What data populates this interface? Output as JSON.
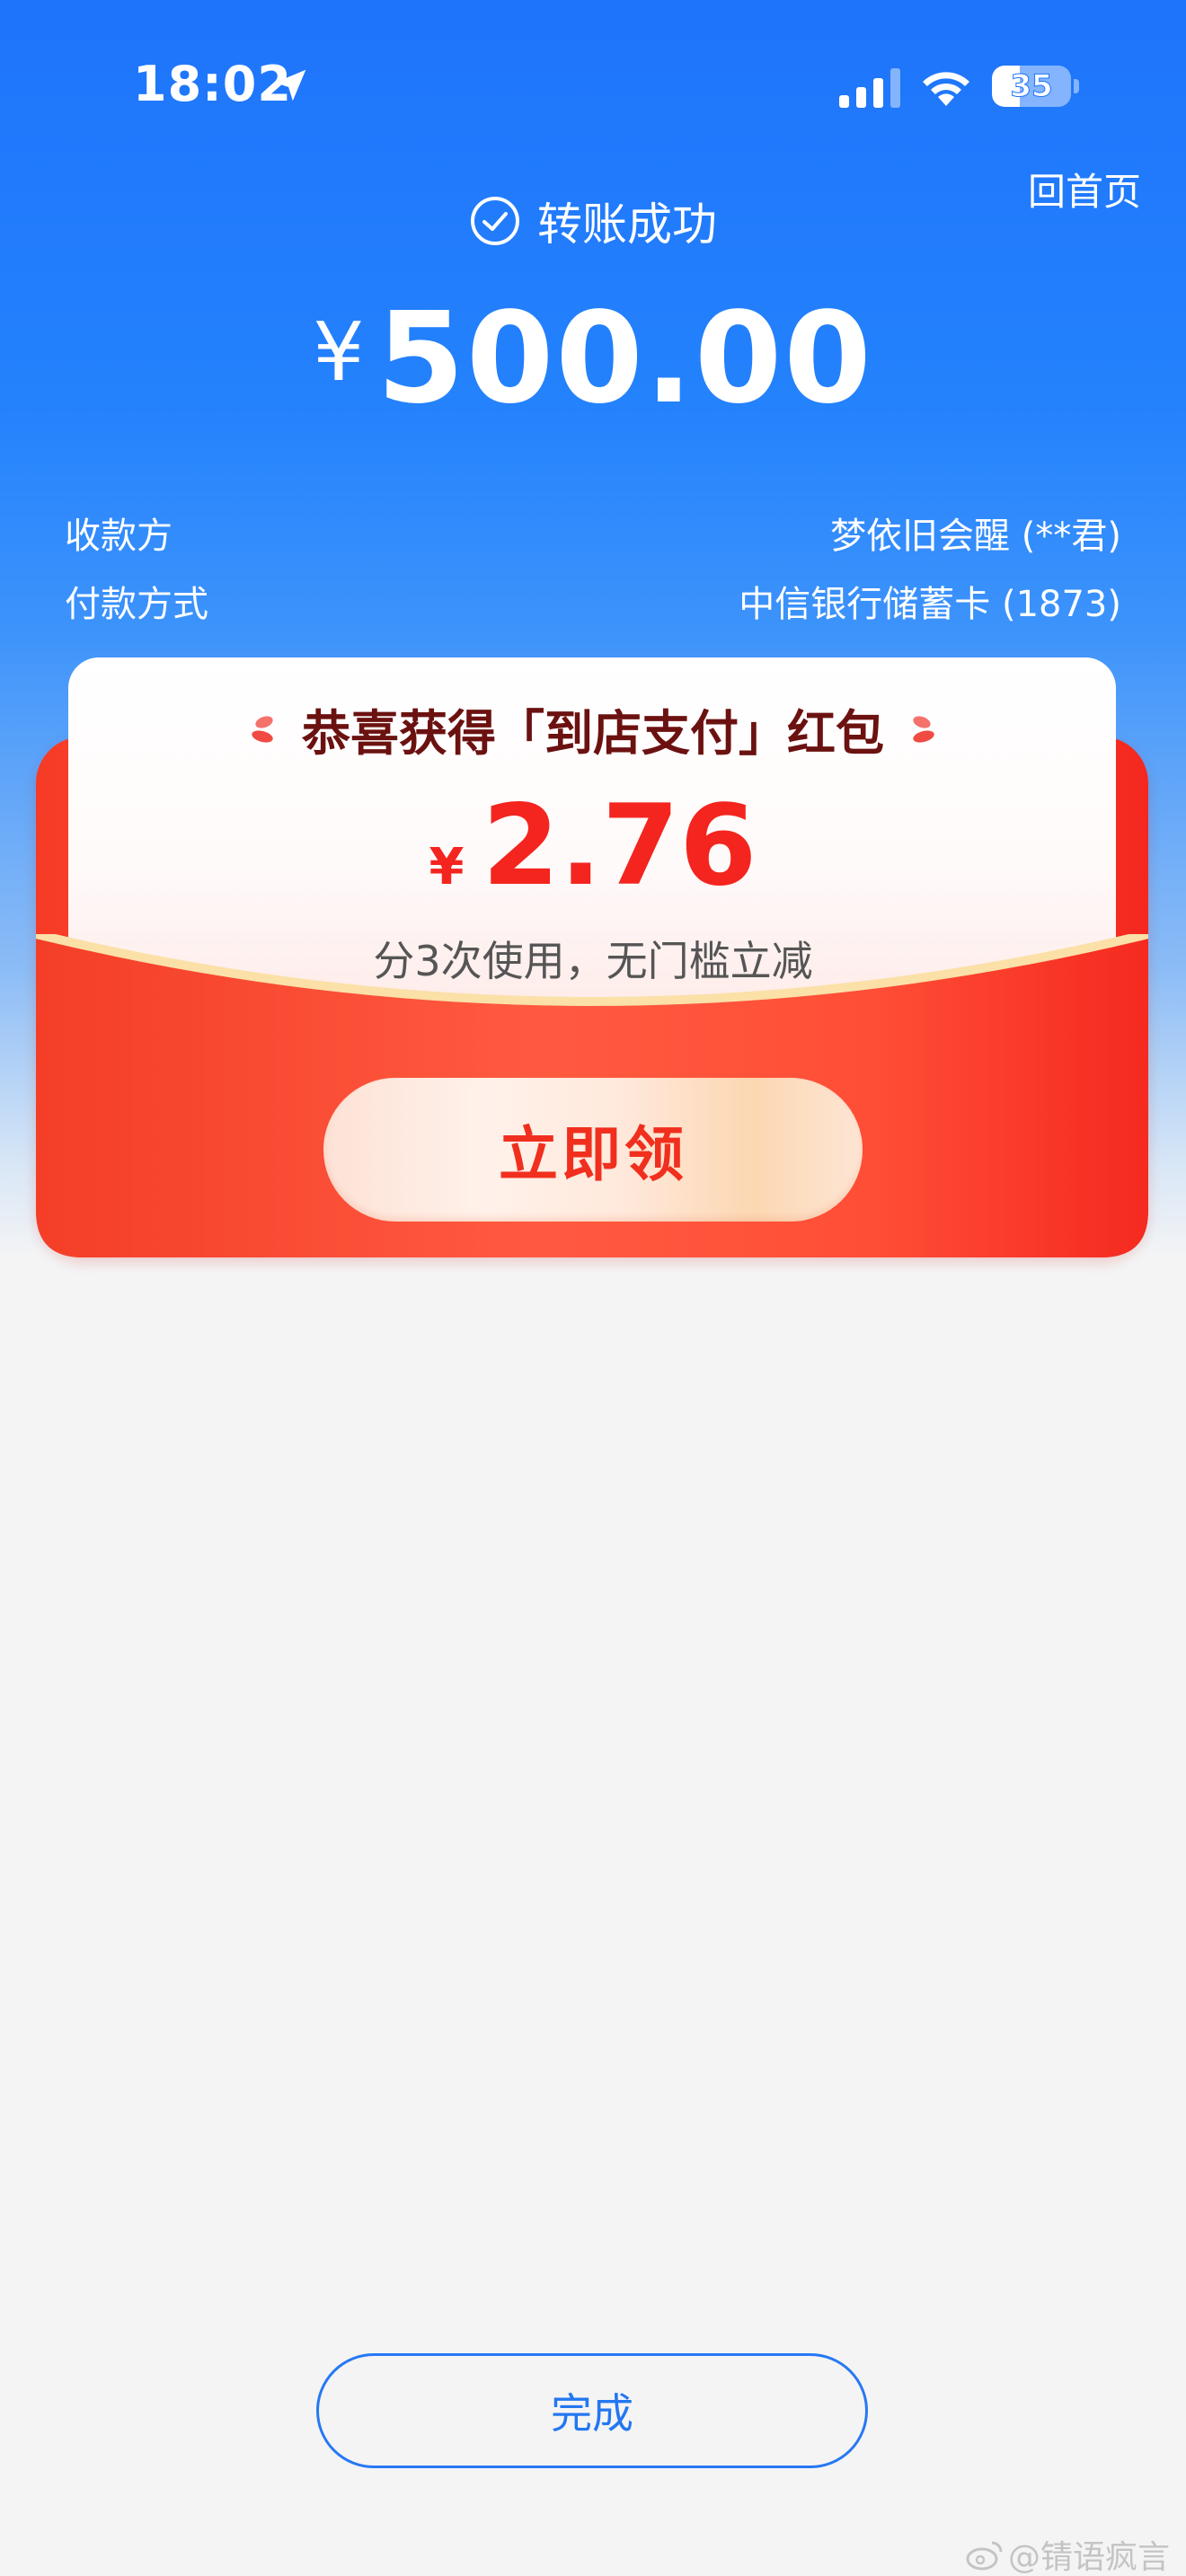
{
  "status_bar": {
    "time": "18:02",
    "battery": "35",
    "battery_level": 0.35
  },
  "header": {
    "home_link": "回首页",
    "status_text": "转账成功"
  },
  "amount": {
    "currency": "¥",
    "value": "500.00"
  },
  "details": [
    {
      "label": "收款方",
      "value": "梦依旧会醒 (**君)"
    },
    {
      "label": "付款方式",
      "value": "中信银行储蓄卡 (1873)"
    }
  ],
  "reward_card": {
    "title": "恭喜获得「到店支付」红包",
    "currency": "¥",
    "amount": "2.76",
    "description": "分3次使用，无门槛立减",
    "claim_label": "立即领"
  },
  "footer": {
    "done_label": "完成"
  },
  "watermark": "@锖语疯言",
  "colors": {
    "primary_blue": "#1e74fb",
    "reward_red": "#f4241e",
    "title_brown": "#6b1211"
  }
}
